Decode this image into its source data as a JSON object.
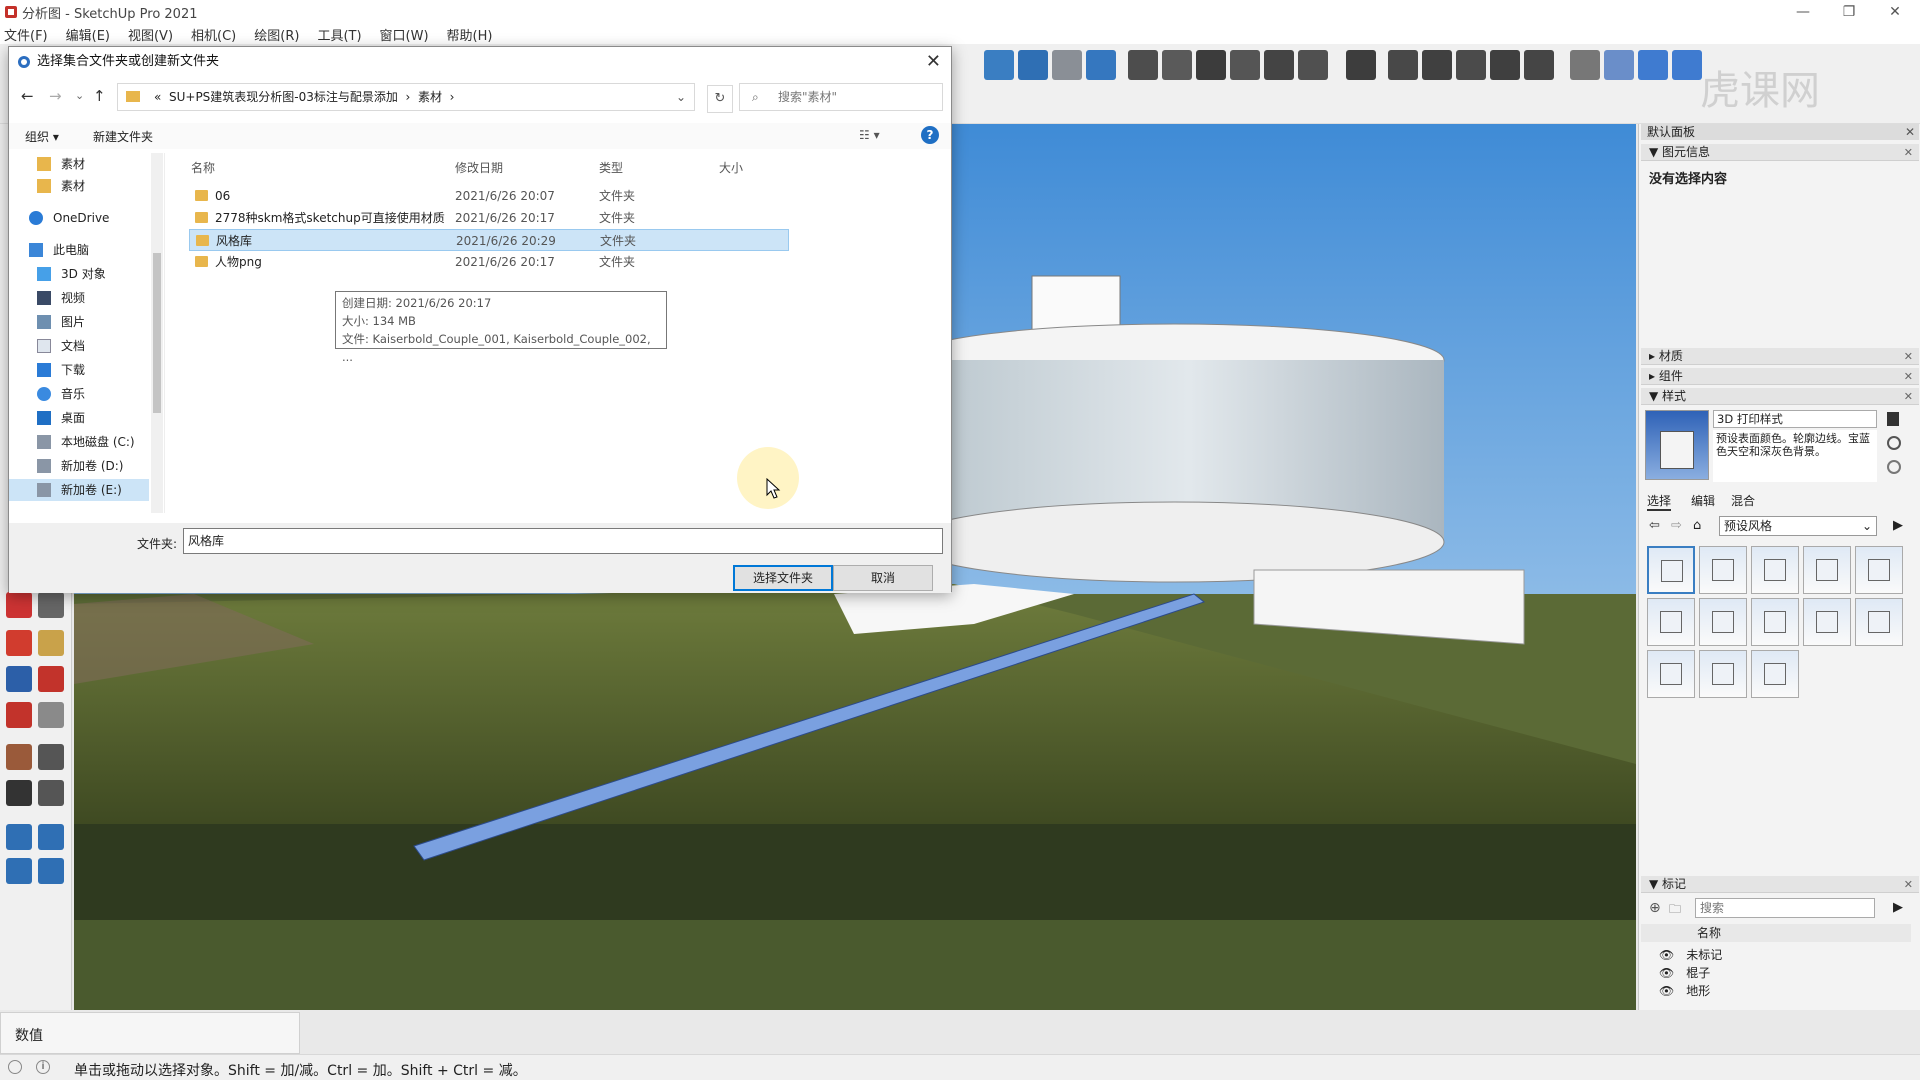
{
  "app": {
    "title": "分析图 - SketchUp Pro 2021",
    "watermark": "虎课网",
    "menu": [
      "文件(F)",
      "编辑(E)",
      "视图(V)",
      "相机(C)",
      "绘图(R)",
      "工具(T)",
      "窗口(W)",
      "帮助(H)"
    ]
  },
  "dialog": {
    "title": "选择集合文件夹或创建新文件夹",
    "breadcrumb": [
      "«",
      "SU+PS建筑表现分析图-03标注与配景添加",
      "›",
      "素材",
      "›"
    ],
    "search_placeholder": "搜索\"素材\"",
    "organize": "组织 ▾",
    "new_folder": "新建文件夹",
    "nav_items": [
      {
        "label": "素材",
        "icon": "folder"
      },
      {
        "label": "素材",
        "icon": "folder"
      },
      {
        "label": "OneDrive",
        "icon": "cloud"
      },
      {
        "label": "此电脑",
        "icon": "computer"
      },
      {
        "label": "3D 对象",
        "icon": "3d-objects"
      },
      {
        "label": "视频",
        "icon": "video"
      },
      {
        "label": "图片",
        "icon": "pictures"
      },
      {
        "label": "文档",
        "icon": "documents"
      },
      {
        "label": "下载",
        "icon": "download"
      },
      {
        "label": "音乐",
        "icon": "music"
      },
      {
        "label": "桌面",
        "icon": "desktop"
      },
      {
        "label": "本地磁盘 (C:)",
        "icon": "drive"
      },
      {
        "label": "新加卷 (D:)",
        "icon": "drive"
      },
      {
        "label": "新加卷 (E:)",
        "icon": "drive"
      }
    ],
    "columns": [
      "名称",
      "修改日期",
      "类型",
      "大小"
    ],
    "rows": [
      {
        "name": "06",
        "date": "2021/6/26 20:07",
        "type": "文件夹",
        "size": ""
      },
      {
        "name": "2778种skm格式sketchup可直接使用材质",
        "date": "2021/6/26 20:17",
        "type": "文件夹",
        "size": ""
      },
      {
        "name": "风格库",
        "date": "2021/6/26 20:29",
        "type": "文件夹",
        "size": ""
      },
      {
        "name": "人物png",
        "date": "2021/6/26 20:17",
        "type": "文件夹",
        "size": ""
      }
    ],
    "tooltip": [
      "创建日期: 2021/6/26 20:17",
      "大小: 134 MB",
      "文件: Kaiserbold_Couple_001, Kaiserbold_Couple_002, ..."
    ],
    "folder_label": "文件夹:",
    "folder_value": "风格库",
    "select_button": "选择文件夹",
    "cancel_button": "取消"
  },
  "tray": {
    "title": "默认面板",
    "entity_info": "图元信息",
    "no_selection": "没有选择内容",
    "materials": "材质",
    "components": "组件",
    "styles": "样式",
    "style_name": "3D 打印样式",
    "style_desc": "预设表面颜色。轮廓边线。宝蓝色天空和深灰色背景。",
    "style_tabs": [
      "选择",
      "编辑",
      "混合"
    ],
    "style_library": "预设风格",
    "tags": "标记",
    "tags_search": "搜索",
    "tags_header": "名称",
    "tag_items": [
      "未标记",
      "棍子",
      "地形"
    ]
  },
  "status": {
    "value_label": "数值",
    "hint": "单击或拖动以选择对象。Shift = 加/减。Ctrl = 加。Shift + Ctrl = 减。"
  }
}
